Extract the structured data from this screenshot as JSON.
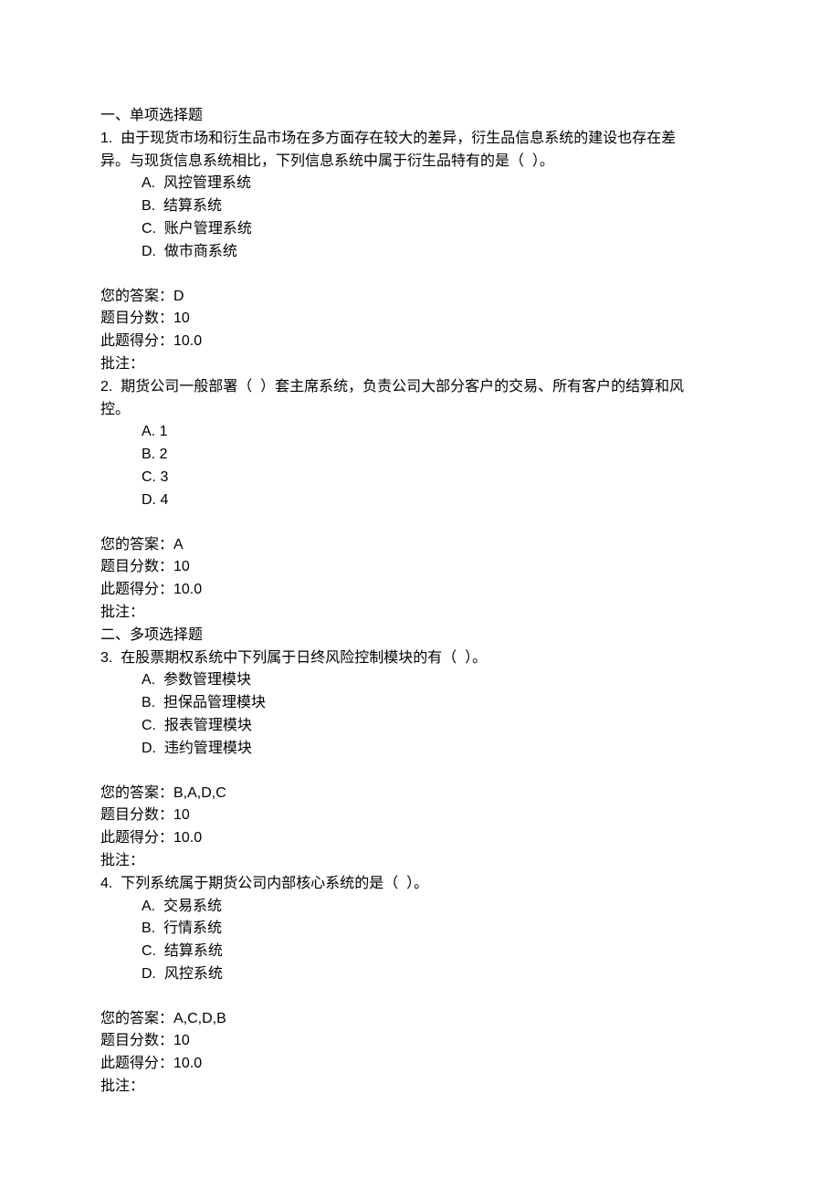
{
  "section1": {
    "title": "一、单项选择题",
    "q1": {
      "stem_l1": "1.  由于现货市场和衍生品市场在多方面存在较大的差异，衍生品信息系统的建设也存在差",
      "stem_l2": "异。与现货信息系统相比，下列信息系统中属于衍生品特有的是（  ）。",
      "options": [
        "A.  风控管理系统",
        "B.  结算系统",
        "C.  账户管理系统",
        "D.  做市商系统"
      ],
      "your_answer": "您的答案：D",
      "full_score": "题目分数：10",
      "got_score": "此题得分：10.0",
      "remark": "批注："
    },
    "q2": {
      "stem_l1": "2.  期货公司一般部署（  ）套主席系统，负责公司大部分客户的交易、所有客户的结算和风",
      "stem_l2": "控。",
      "options": [
        "A. 1",
        "B. 2",
        "C. 3",
        "D. 4"
      ],
      "your_answer": "您的答案：A",
      "full_score": "题目分数：10",
      "got_score": "此题得分：10.0",
      "remark": "批注："
    }
  },
  "section2": {
    "title": "二、多项选择题",
    "q3": {
      "stem": "3.  在股票期权系统中下列属于日终风险控制模块的有（  ）。",
      "options": [
        "A.  参数管理模块",
        "B.  担保品管理模块",
        "C.  报表管理模块",
        "D.  违约管理模块"
      ],
      "your_answer": "您的答案：B,A,D,C",
      "full_score": "题目分数：10",
      "got_score": "此题得分：10.0",
      "remark": "批注："
    },
    "q4": {
      "stem": "4.  下列系统属于期货公司内部核心系统的是（  ）。",
      "options": [
        "A.  交易系统",
        "B.  行情系统",
        "C.  结算系统",
        "D.  风控系统"
      ],
      "your_answer": "您的答案：A,C,D,B",
      "full_score": "题目分数：10",
      "got_score": "此题得分：10.0",
      "remark": "批注："
    }
  }
}
